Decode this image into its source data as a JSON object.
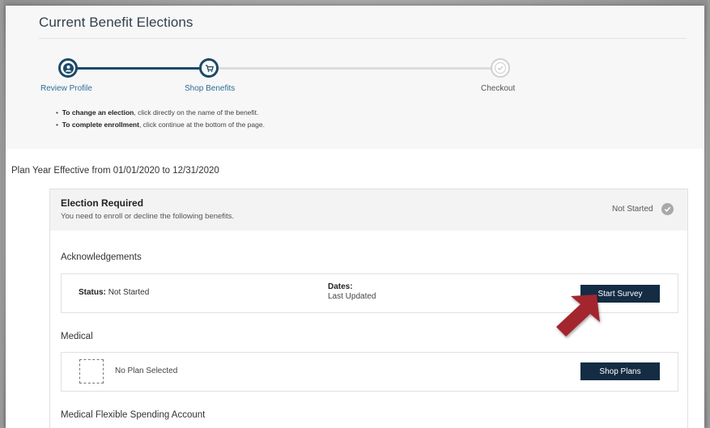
{
  "page": {
    "title": "Current Benefit Elections"
  },
  "stepper": {
    "steps": [
      {
        "label": "Review Profile",
        "icon": "user-icon",
        "state": "complete"
      },
      {
        "label": "Shop Benefits",
        "icon": "cart-icon",
        "state": "current"
      },
      {
        "label": "Checkout",
        "icon": "check-icon",
        "state": "upcoming"
      }
    ]
  },
  "instructions": [
    {
      "bold": "To change an election",
      "rest": ", click directly on the name of the benefit."
    },
    {
      "bold": "To complete enrollment",
      "rest": ", click continue at the bottom of the page."
    }
  ],
  "plan_year": "Plan Year Effective from 01/01/2020 to 12/31/2020",
  "election": {
    "title": "Election Required",
    "subtitle": "You need to enroll or decline the following benefits.",
    "status": "Not Started"
  },
  "sections": {
    "acknowledgements": {
      "title": "Acknowledgements",
      "status_label": "Status:",
      "status_value": "Not Started",
      "dates_label": "Dates:",
      "dates_value": "Last Updated",
      "button": "Start Survey"
    },
    "medical": {
      "title": "Medical",
      "empty_text": "No Plan Selected",
      "button": "Shop Plans"
    },
    "fsa": {
      "title": "Medical Flexible Spending Account"
    }
  },
  "colors": {
    "primary_dark": "#142c44",
    "stepper_active": "#1b4a68",
    "link_blue": "#2d6e99",
    "arrow_red": "#a3262f"
  }
}
